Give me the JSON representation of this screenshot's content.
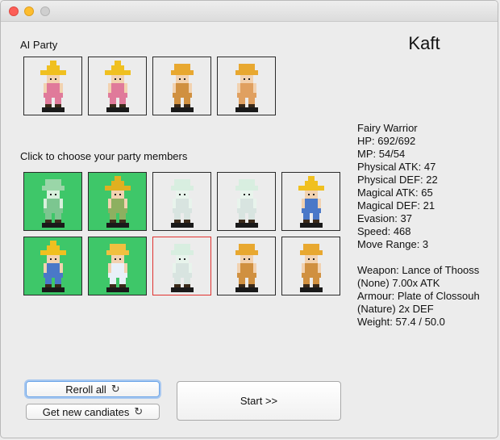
{
  "ai_party": {
    "label": "AI Party",
    "members": [
      {
        "sprite": "black-mage-red-robe-icon",
        "hat": "#f0c020",
        "hat_tall": true,
        "robe": "#e07a9a",
        "skin": "#f2d2b0"
      },
      {
        "sprite": "black-mage-red-robe-icon",
        "hat": "#f0c020",
        "hat_tall": true,
        "robe": "#e07a9a",
        "skin": "#f2d2b0"
      },
      {
        "sprite": "blonde-purple-warrior-icon",
        "hat": "#e8a830",
        "hat_tall": false,
        "robe": "#d09040",
        "skin": "#f2d2b0"
      },
      {
        "sprite": "blonde-orange-warrior-icon",
        "hat": "#e8a830",
        "hat_tall": false,
        "robe": "#e0a060",
        "skin": "#f2d2b0"
      }
    ]
  },
  "character_name": "Kaft",
  "choose_label": "Click to choose your party members",
  "candidates": [
    {
      "sprite": "green-knight-icon",
      "selected": true,
      "highlight": false,
      "hat": "#9ad6a8",
      "hat_tall": false,
      "robe": "#7cc690",
      "skin": "#d8f0dc"
    },
    {
      "sprite": "yellow-hat-green-mage-icon",
      "selected": true,
      "highlight": false,
      "hat": "#e0b020",
      "hat_tall": true,
      "robe": "#8db060",
      "skin": "#f2d2b0"
    },
    {
      "sprite": "pale-ghost-warrior-icon",
      "selected": false,
      "highlight": false,
      "hat": "#d8eee0",
      "hat_tall": false,
      "robe": "#d8e4e0",
      "skin": "#e8f4ec"
    },
    {
      "sprite": "pale-ghost-warrior-icon",
      "selected": false,
      "highlight": false,
      "hat": "#d8eee0",
      "hat_tall": false,
      "robe": "#d8e4e0",
      "skin": "#e8f4ec"
    },
    {
      "sprite": "black-mage-blue-robe-icon",
      "selected": false,
      "highlight": false,
      "hat": "#f0c020",
      "hat_tall": true,
      "robe": "#4a78c8",
      "skin": "#f2d2b0"
    },
    {
      "sprite": "black-mage-blue-robe-icon",
      "selected": true,
      "highlight": false,
      "hat": "#f0c020",
      "hat_tall": true,
      "robe": "#4a78c8",
      "skin": "#f2d2b0"
    },
    {
      "sprite": "white-mage-blonde-icon",
      "selected": true,
      "highlight": false,
      "hat": "#f0c040",
      "hat_tall": false,
      "robe": "#e8f0f8",
      "skin": "#f2d2b0"
    },
    {
      "sprite": "pale-ghost-warrior-icon",
      "selected": false,
      "highlight": true,
      "hat": "#d8eee0",
      "hat_tall": false,
      "robe": "#d8e4e0",
      "skin": "#e8f4ec"
    },
    {
      "sprite": "blonde-green-warrior-icon",
      "selected": false,
      "highlight": false,
      "hat": "#e8a830",
      "hat_tall": false,
      "robe": "#d09040",
      "skin": "#f2d2b0"
    },
    {
      "sprite": "blonde-green-warrior-icon",
      "selected": false,
      "highlight": false,
      "hat": "#e8a830",
      "hat_tall": false,
      "robe": "#d09040",
      "skin": "#f2d2b0"
    }
  ],
  "stats": {
    "class": "Fairy Warrior",
    "hp": "HP: 692/692",
    "mp": "MP: 54/54",
    "physical_atk": "Physical ATK: 47",
    "physical_def": "Physical DEF: 22",
    "magical_atk": "Magical ATK: 65",
    "magical_def": "Magical DEF: 21",
    "evasion": "Evasion: 37",
    "speed": "Speed: 468",
    "move_range": "Move Range: 3",
    "weapon": "Weapon: Lance of Thooss (None) 7.00x ATK",
    "armour": "Armour: Plate of Clossouh (Nature) 2x DEF",
    "weight": "Weight: 57.4 / 50.0"
  },
  "buttons": {
    "reroll_label": "Reroll all",
    "new_candidates_label": "Get new candiates",
    "start_label": "Start >>",
    "refresh_glyph": "↻"
  },
  "colors": {
    "selected": "#3ec769",
    "highlight_border": "#e0322f",
    "focus_ring": "#6aa4e8"
  }
}
